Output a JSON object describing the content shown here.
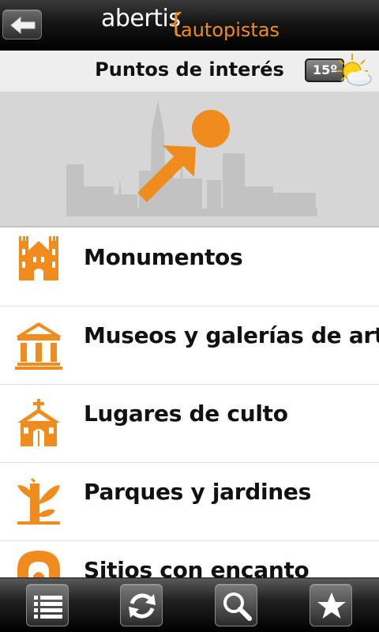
{
  "header": {
    "logo_primary": "abertis",
    "logo_brace": "{",
    "logo_secondary": "autopistas",
    "back_icon": "back-arrow-icon"
  },
  "titlebar": {
    "title": "Puntos de interés",
    "temperature": "15º",
    "weather_icon": "sun-cloud-icon"
  },
  "banner": {
    "icon": "city-skyline-pin-icon"
  },
  "list": {
    "items": [
      {
        "label": "Monumentos",
        "icon": "monument-castle-icon"
      },
      {
        "label": "Museos y galerías de arte",
        "icon": "museum-icon"
      },
      {
        "label": "Lugares de culto",
        "icon": "church-icon"
      },
      {
        "label": "Parques y jardines",
        "icon": "park-plant-icon"
      },
      {
        "label": "Sitios con encanto",
        "icon": "arch-icon"
      }
    ]
  },
  "tabbar": {
    "items": [
      {
        "name": "list-tab",
        "icon": "list-icon"
      },
      {
        "name": "refresh-tab",
        "icon": "refresh-icon"
      },
      {
        "name": "search-tab",
        "icon": "search-icon"
      },
      {
        "name": "favorites-tab",
        "icon": "star-icon"
      }
    ]
  },
  "colors": {
    "accent": "#f08c1e",
    "title_bg": "#eeeeee",
    "banner_bg": "#d6d6d6",
    "text": "#111111"
  }
}
